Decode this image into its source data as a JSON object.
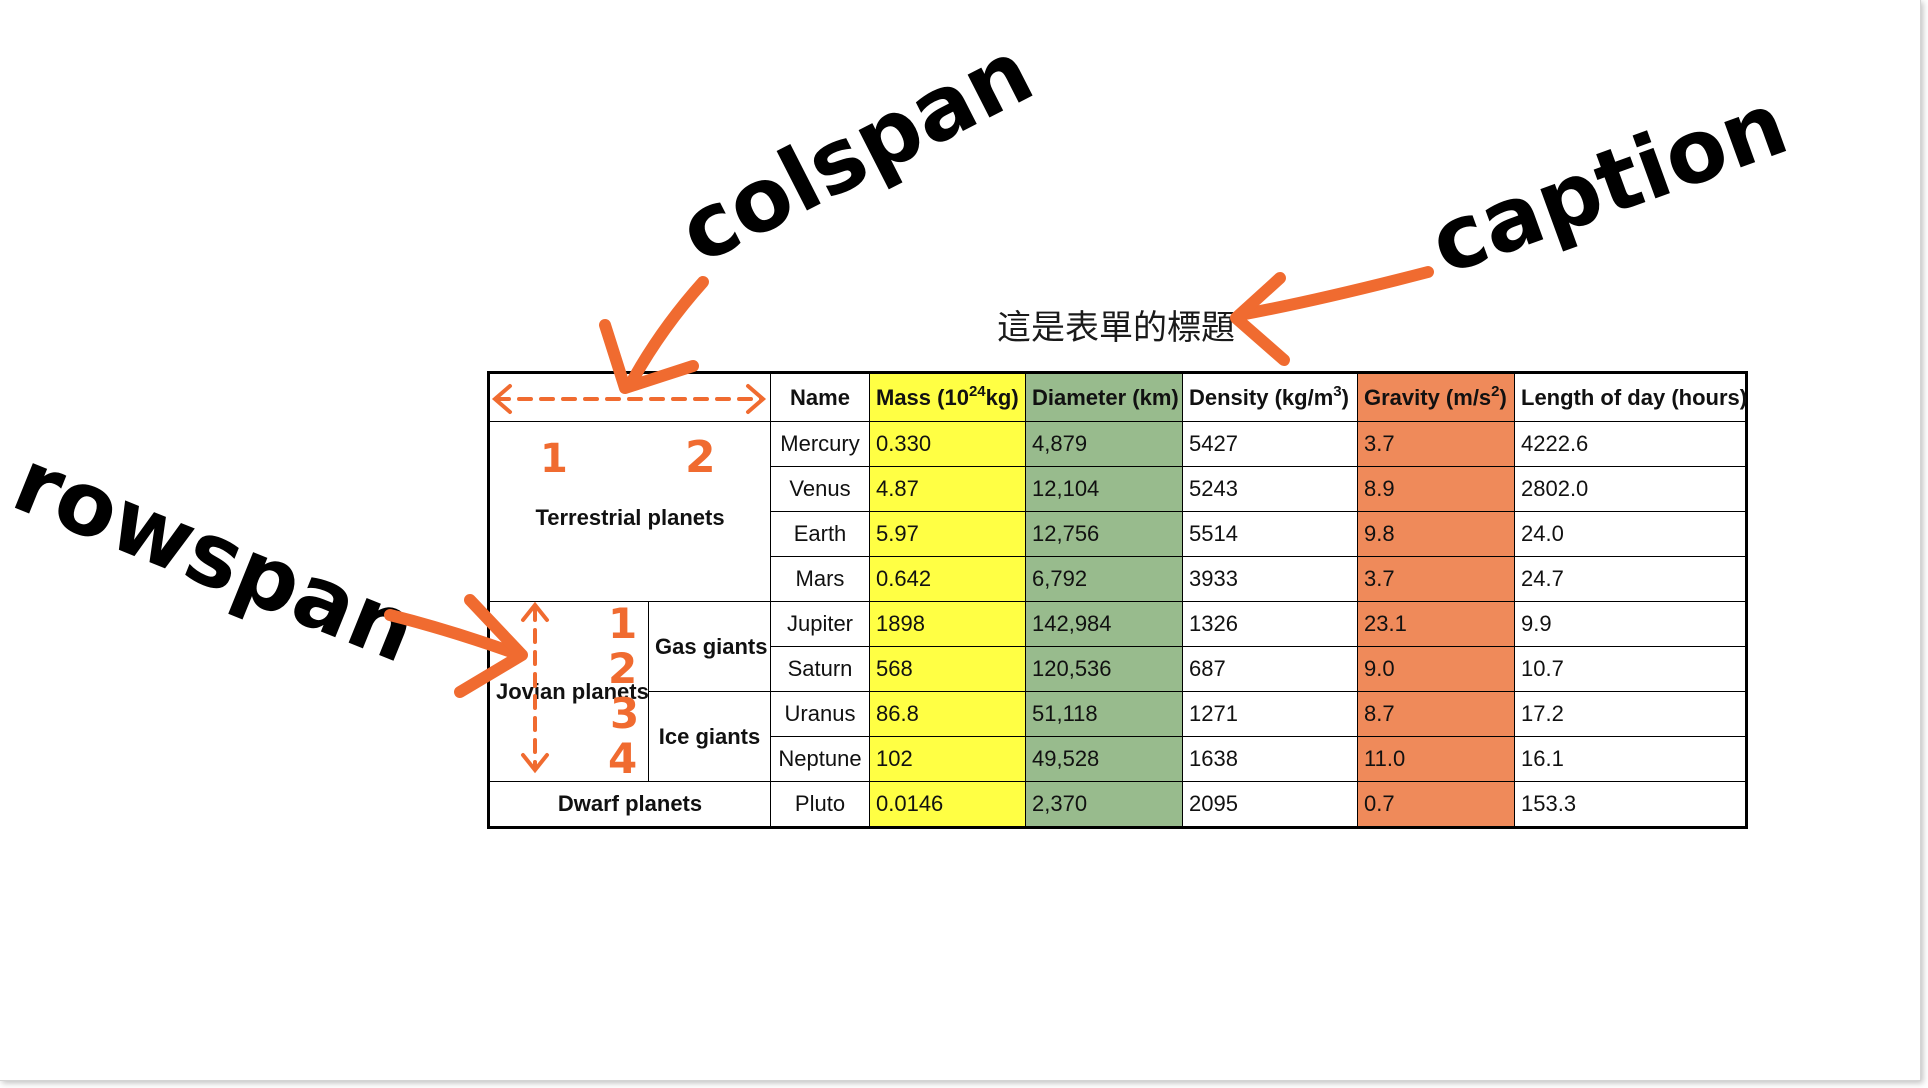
{
  "caption": "這是表單的標題",
  "annotations": {
    "colspan": "colspan",
    "rowspan": "rowspan",
    "caption": "caption",
    "colspan_numbers": [
      "1",
      "2"
    ],
    "rowspan_numbers": [
      "1",
      "2",
      "3",
      "4"
    ],
    "accent_color": "#f06b30"
  },
  "table": {
    "headers": {
      "name": "Name",
      "mass": "Mass (10",
      "mass_sup": "24",
      "mass_unit": "kg)",
      "diameter": "Diameter (km)",
      "density": "Density (kg/m",
      "density_sup": "3",
      "density_end": ")",
      "gravity": "Gravity (m/s",
      "gravity_sup": "2",
      "gravity_end": ")",
      "day": "Length of day (hours)"
    },
    "groups": {
      "terrestrial": "Terrestrial planets",
      "jovian": "Jovian planets",
      "gas_giants": "Gas giants",
      "ice_giants": "Ice giants",
      "dwarf": "Dwarf planets"
    },
    "rows": [
      {
        "name": "Mercury",
        "mass": "0.330",
        "diameter": "4,879",
        "density": "5427",
        "gravity": "3.7",
        "day": "4222.6"
      },
      {
        "name": "Venus",
        "mass": "4.87",
        "diameter": "12,104",
        "density": "5243",
        "gravity": "8.9",
        "day": "2802.0"
      },
      {
        "name": "Earth",
        "mass": "5.97",
        "diameter": "12,756",
        "density": "5514",
        "gravity": "9.8",
        "day": "24.0"
      },
      {
        "name": "Mars",
        "mass": "0.642",
        "diameter": "6,792",
        "density": "3933",
        "gravity": "3.7",
        "day": "24.7"
      },
      {
        "name": "Jupiter",
        "mass": "1898",
        "diameter": "142,984",
        "density": "1326",
        "gravity": "23.1",
        "day": "9.9"
      },
      {
        "name": "Saturn",
        "mass": "568",
        "diameter": "120,536",
        "density": "687",
        "gravity": "9.0",
        "day": "10.7"
      },
      {
        "name": "Uranus",
        "mass": "86.8",
        "diameter": "51,118",
        "density": "1271",
        "gravity": "8.7",
        "day": "17.2"
      },
      {
        "name": "Neptune",
        "mass": "102",
        "diameter": "49,528",
        "density": "1638",
        "gravity": "11.0",
        "day": "16.1"
      },
      {
        "name": "Pluto",
        "mass": "0.0146",
        "diameter": "2,370",
        "density": "2095",
        "gravity": "0.7",
        "day": "153.3"
      }
    ],
    "colors": {
      "mass": "#ffff44",
      "diameter": "#98bb8d",
      "gravity": "#ef8a5a"
    }
  }
}
